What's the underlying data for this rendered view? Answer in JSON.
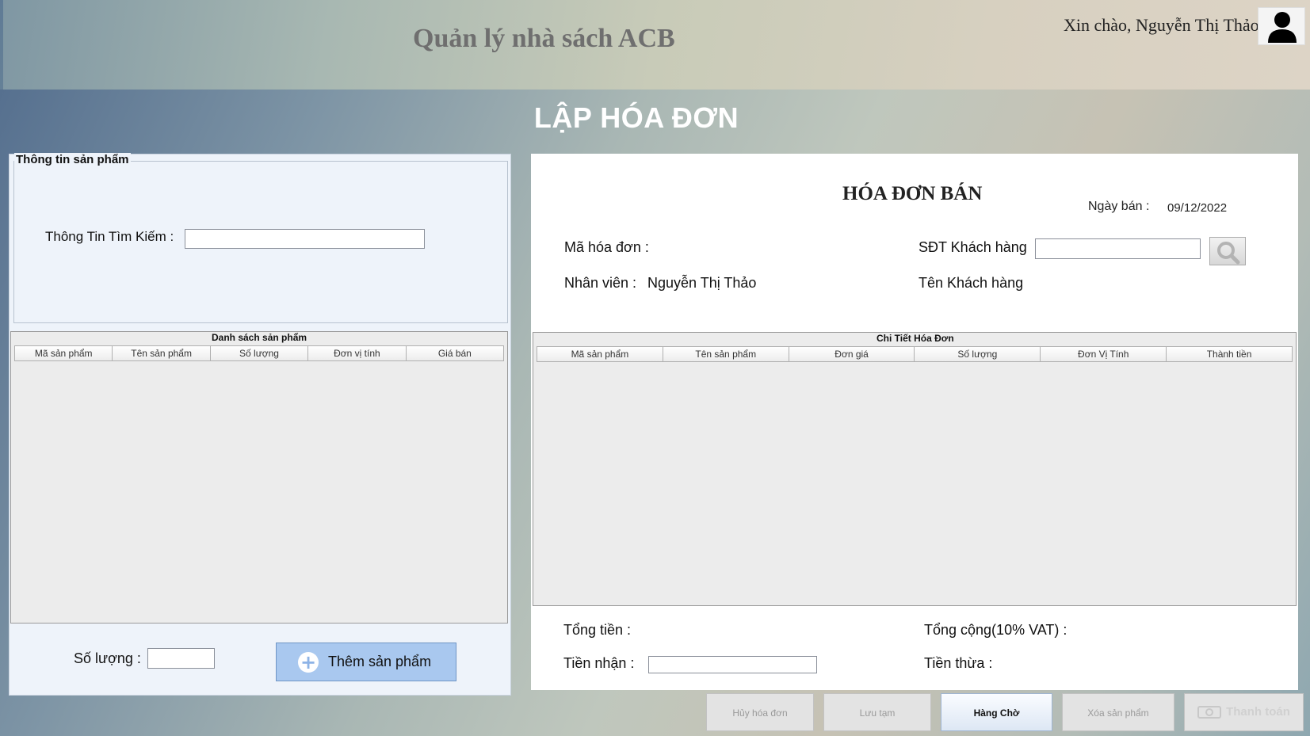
{
  "app": {
    "title": "Quản lý nhà sách ACB",
    "greeting": "Xin chào, Nguyễn Thị Thảo"
  },
  "page": {
    "title": "LẬP HÓA ĐƠN"
  },
  "product_info": {
    "section_title": "Thông tin sản phẩm",
    "search_label": "Thông Tin Tìm Kiếm :",
    "search_value": "",
    "list_title": "Danh sách sản phẩm",
    "columns": [
      "Mã sản phẩm",
      "Tên sản phẩm",
      "Số lượng",
      "Đơn vị tính",
      "Giá bán"
    ],
    "rows": [],
    "quantity_label": "Số lượng :",
    "quantity_value": "",
    "add_button": "Thêm sản phẩm"
  },
  "invoice": {
    "title": "HÓA ĐƠN BÁN",
    "date_label": "Ngày bán :",
    "date_value": "09/12/2022",
    "invoice_id_label": "Mã hóa đơn :",
    "invoice_id_value": "",
    "phone_label": "SĐT Khách hàng",
    "phone_value": "",
    "staff_label": "Nhân viên :",
    "staff_value": "Nguyễn Thị Thảo",
    "customer_name_label": "Tên Khách hàng",
    "detail_title": "Chi Tiết Hóa Đơn",
    "detail_columns": [
      "Mã sản phẩm",
      "Tên sản phẩm",
      "Đơn giá",
      "Số lượng",
      "Đơn Vị Tính",
      "Thành tiền"
    ],
    "detail_rows": [],
    "total_label": "Tổng tiền :",
    "grand_total_label": "Tổng cộng(10% VAT) :",
    "received_label": "Tiền nhận :",
    "received_value": "",
    "change_label": "Tiền thừa :"
  },
  "actions": {
    "cancel": "Hủy hóa đơn",
    "save_temp": "Lưu tạm",
    "queue": "Hàng Chờ",
    "delete_product": "Xóa sản phẩm",
    "pay": "Thanh toán"
  },
  "icons": {
    "avatar": "user-icon",
    "search": "magnifier-icon",
    "add": "plus-circle-icon",
    "pay": "money-icon"
  }
}
